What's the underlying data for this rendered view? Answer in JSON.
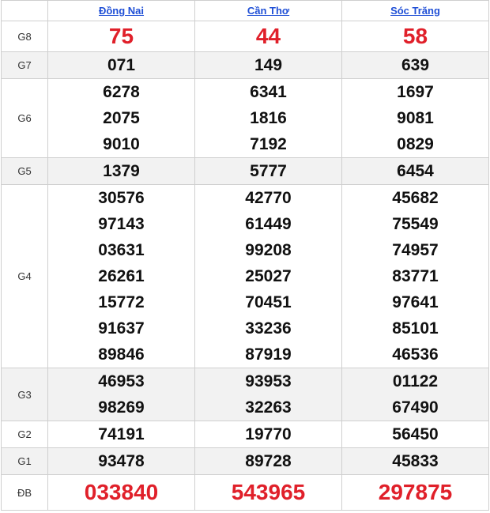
{
  "provinces": [
    "Đồng Nai",
    "Cần Thơ",
    "Sóc Trăng"
  ],
  "rows": [
    {
      "label": "G8",
      "values": [
        [
          "75"
        ],
        [
          "44"
        ],
        [
          "58"
        ]
      ],
      "red": true
    },
    {
      "label": "G7",
      "values": [
        [
          "071"
        ],
        [
          "149"
        ],
        [
          "639"
        ]
      ]
    },
    {
      "label": "G6",
      "values": [
        [
          "6278",
          "2075",
          "9010"
        ],
        [
          "6341",
          "1816",
          "7192"
        ],
        [
          "1697",
          "9081",
          "0829"
        ]
      ]
    },
    {
      "label": "G5",
      "values": [
        [
          "1379"
        ],
        [
          "5777"
        ],
        [
          "6454"
        ]
      ]
    },
    {
      "label": "G4",
      "values": [
        [
          "30576",
          "97143",
          "03631",
          "26261",
          "15772",
          "91637",
          "89846"
        ],
        [
          "42770",
          "61449",
          "99208",
          "25027",
          "70451",
          "33236",
          "87919"
        ],
        [
          "45682",
          "75549",
          "74957",
          "83771",
          "97641",
          "85101",
          "46536"
        ]
      ]
    },
    {
      "label": "G3",
      "values": [
        [
          "46953",
          "98269"
        ],
        [
          "93953",
          "32263"
        ],
        [
          "01122",
          "67490"
        ]
      ]
    },
    {
      "label": "G2",
      "values": [
        [
          "74191"
        ],
        [
          "19770"
        ],
        [
          "56450"
        ]
      ]
    },
    {
      "label": "G1",
      "values": [
        [
          "93478"
        ],
        [
          "89728"
        ],
        [
          "45833"
        ]
      ]
    },
    {
      "label": "ĐB",
      "values": [
        [
          "033840"
        ],
        [
          "543965"
        ],
        [
          "297875"
        ]
      ],
      "red": true
    }
  ],
  "colors": {
    "header_link": "#1f4fd6",
    "highlight": "#e0202a",
    "alt_row": "#f2f2f2"
  }
}
